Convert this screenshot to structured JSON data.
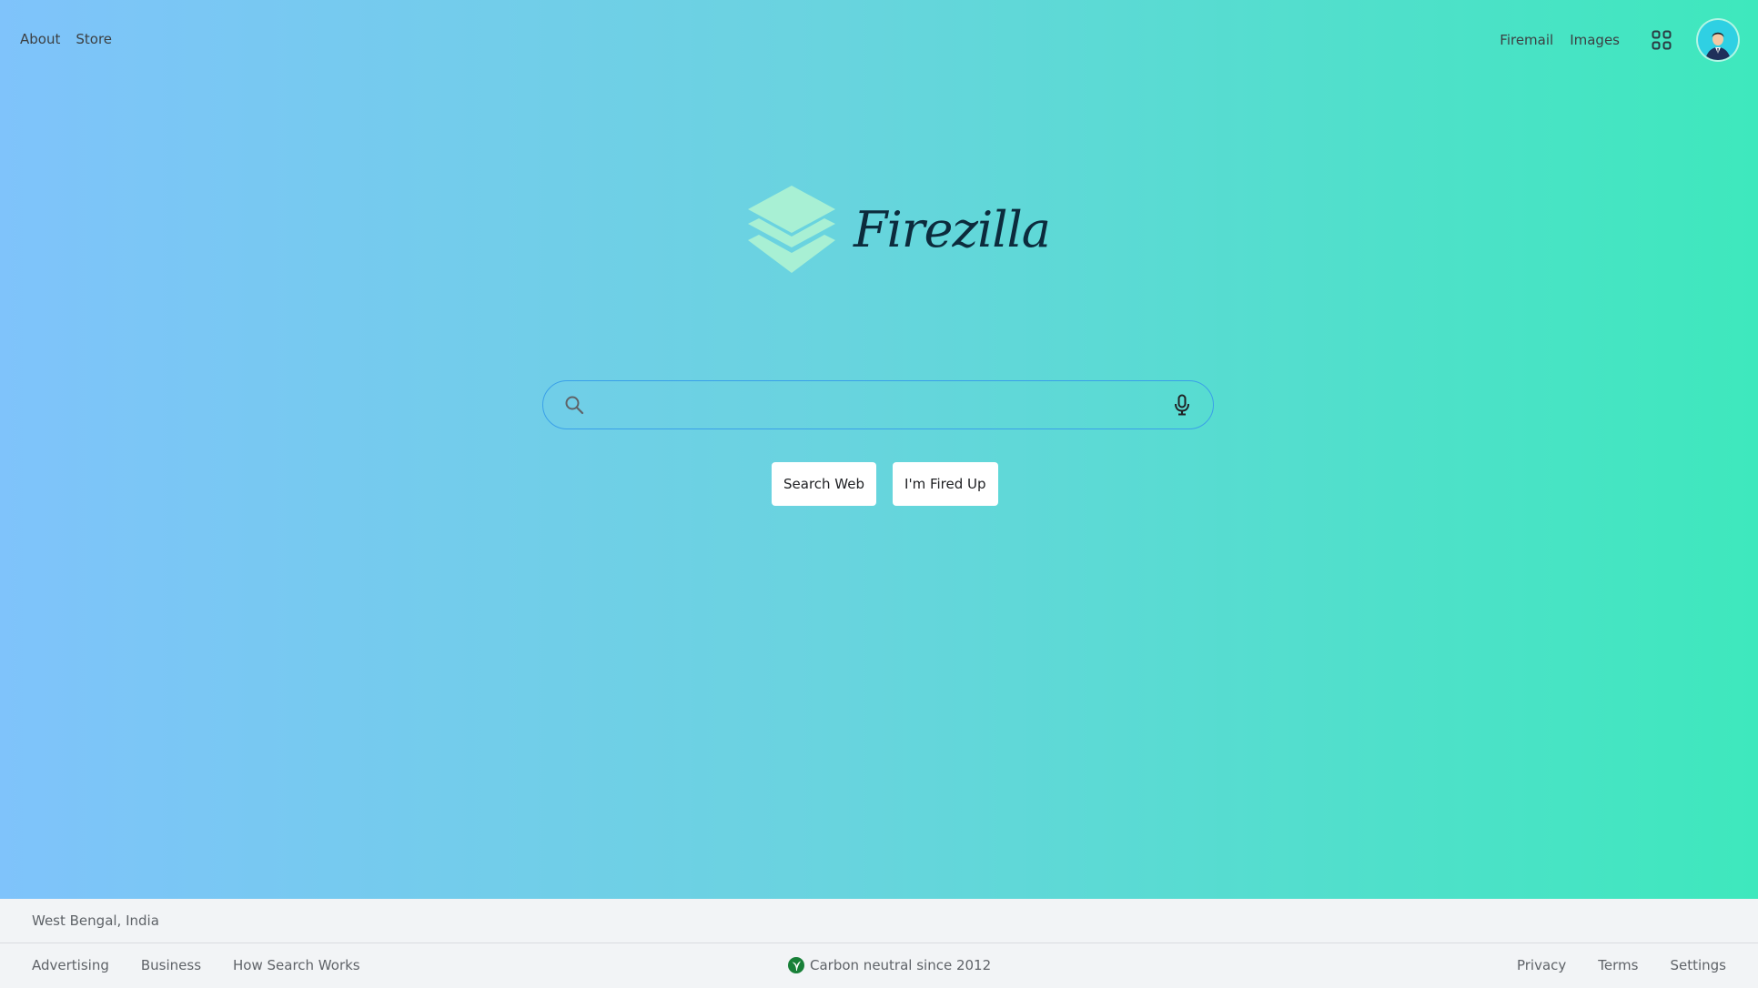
{
  "header": {
    "left_links": [
      "About",
      "Store"
    ],
    "right_links": [
      "Firemail",
      "Images"
    ],
    "apps_icon": "grid-icon",
    "avatar_icon": "user-avatar"
  },
  "logo": {
    "text": "Firezilla",
    "icon": "layers-icon",
    "icon_color": "#a8f0d4"
  },
  "search": {
    "placeholder": "",
    "value": "",
    "search_icon": "search-icon",
    "mic_icon": "microphone-icon"
  },
  "buttons": {
    "search_web": "Search Web",
    "fired_up": "I'm Fired Up"
  },
  "footer": {
    "location": "West Bengal, India",
    "left_links": [
      "Advertising",
      "Business",
      "How Search Works"
    ],
    "carbon": "Carbon neutral since 2012",
    "carbon_icon": "leaf-icon",
    "right_links": [
      "Privacy",
      "Terms",
      "Settings"
    ]
  },
  "colors": {
    "gradient_start": "#7fc3fb",
    "gradient_end": "#3ee8bd",
    "search_border": "#3aa0e8",
    "logo_text": "#0c2b3c",
    "carbon_icon": "#188038"
  }
}
